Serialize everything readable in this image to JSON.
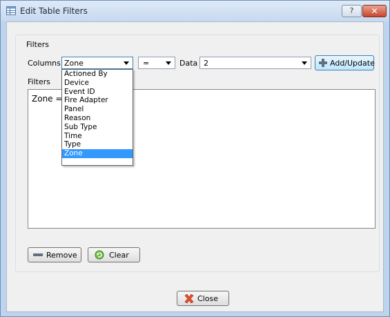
{
  "window": {
    "title": "Edit Table Filters",
    "help_label": "?",
    "close_label": "✕"
  },
  "groupbox": {
    "title": "Filters"
  },
  "columns": {
    "label": "Columns",
    "selected": "Zone",
    "options": [
      "Actioned By",
      "Device",
      "Event ID",
      "Fire Adapter",
      "Panel",
      "Reason",
      "Sub Type",
      "Time",
      "Type",
      "Zone"
    ]
  },
  "operator": {
    "selected": "="
  },
  "data": {
    "label": "Data",
    "value": "2"
  },
  "add_update_label": "Add/Update",
  "filters": {
    "label": "Filters",
    "items": [
      "Zone = 2"
    ]
  },
  "remove_label": "Remove",
  "clear_label": "Clear",
  "close_label": "Close"
}
